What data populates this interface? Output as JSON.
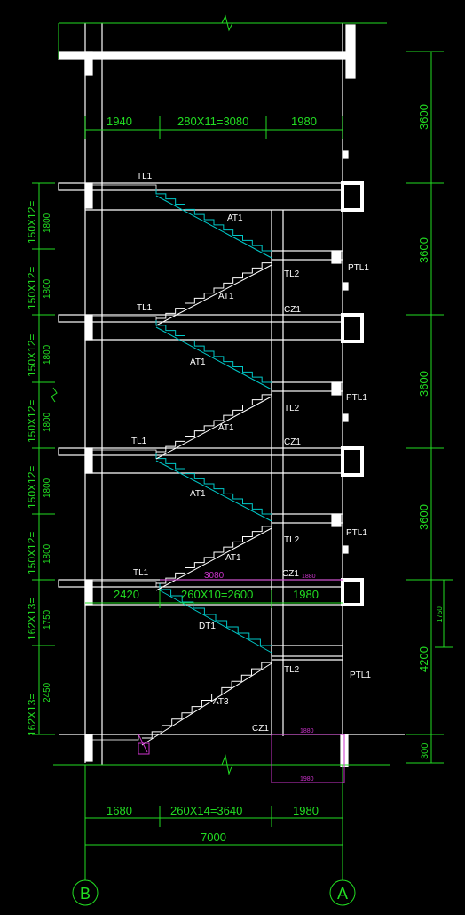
{
  "colors": {
    "background": "#000000",
    "dimension": "#22dd22",
    "structure": "#ffffff",
    "stair_flight": "#00c8c8",
    "highlight": "#cc33cc",
    "grid_line": "#22dd22"
  },
  "dims_top": {
    "left": "1940",
    "middle": "280X11=3080",
    "right": "1980"
  },
  "dims_mid": {
    "left": "2420",
    "middle": "260X10=2600",
    "right": "1980"
  },
  "dims_bottom": {
    "left": "1680",
    "middle": "260X14=3640",
    "right": "1980",
    "total": "7000"
  },
  "dims_right": {
    "floor1": "3600",
    "floor2": "3600",
    "floor3": "3600",
    "floor4": "3600",
    "floor5": "4200",
    "base": "300",
    "small": "1750"
  },
  "dims_left": {
    "f1": "150X12=",
    "f1b": "1800",
    "f2": "150X12=",
    "f2b": "1800",
    "f3": "150X12=",
    "f3b": "1800",
    "f4": "150X12=",
    "f4b": "1800",
    "f5": "150X12=",
    "f5b": "1800",
    "f6": "150X12=",
    "f6b": "1800",
    "f7": "162X13=",
    "f7b": "1750",
    "f8": "162X13=",
    "f8b": "2450"
  },
  "labels": {
    "tl1": "TL1",
    "tl2": "TL2",
    "at1": "AT1",
    "at3": "AT3",
    "dt1": "DT1",
    "ptl1": "PTL1",
    "cz1": "CZ1"
  },
  "magenta": {
    "top_dim": "3080",
    "top_small": "1880",
    "mid_small": "1880",
    "bottom": "1980"
  },
  "grid": {
    "left": "B",
    "right": "A"
  }
}
